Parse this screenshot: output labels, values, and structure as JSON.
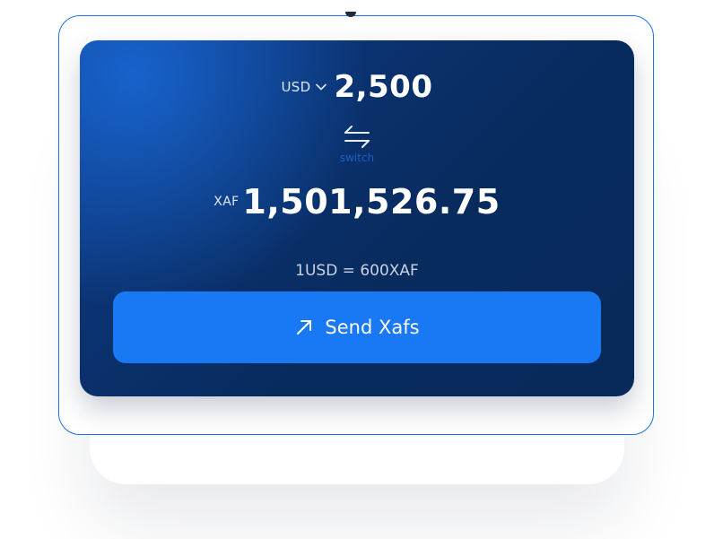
{
  "converter": {
    "from_currency": "USD",
    "from_amount": "2,500",
    "switch_label": "switch",
    "to_currency": "XAF",
    "to_amount": "1,501,526.75",
    "rate": "1USD = 600XAF",
    "send_label": "Send Xafs"
  },
  "colors": {
    "frame_border": "#1a73e8",
    "card_dark": "#082b5e",
    "card_highlight": "#1969d7",
    "button": "#1978f4",
    "switch_label": "#1d5fc9"
  },
  "icons": {
    "currency_dropdown": "chevron-down-icon",
    "switch": "swap-arrows-icon",
    "send": "arrow-up-right-icon"
  }
}
